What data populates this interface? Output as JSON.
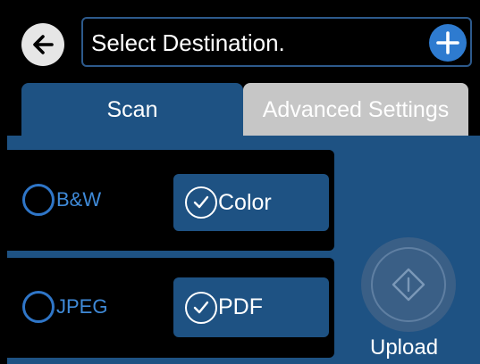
{
  "header": {
    "back_icon": "arrow-left-icon",
    "destination_text": "Select Destination.",
    "add_icon": "plus-icon"
  },
  "tabs": [
    {
      "label": "Scan",
      "selected": true
    },
    {
      "label": "Advanced Settings",
      "selected": false
    }
  ],
  "color_mode": {
    "options": [
      "B&W",
      "Color"
    ],
    "selected": "Color"
  },
  "file_format": {
    "options": [
      "JPEG",
      "PDF"
    ],
    "selected": "PDF"
  },
  "upload": {
    "label": "Upload",
    "icon": "diamond-start-icon",
    "enabled": false
  },
  "colors": {
    "accent": "#1e5283",
    "add_button": "#2e7bd0",
    "inactive_tab": "#c6c6c6",
    "radio_text": "#3f8ad8"
  }
}
